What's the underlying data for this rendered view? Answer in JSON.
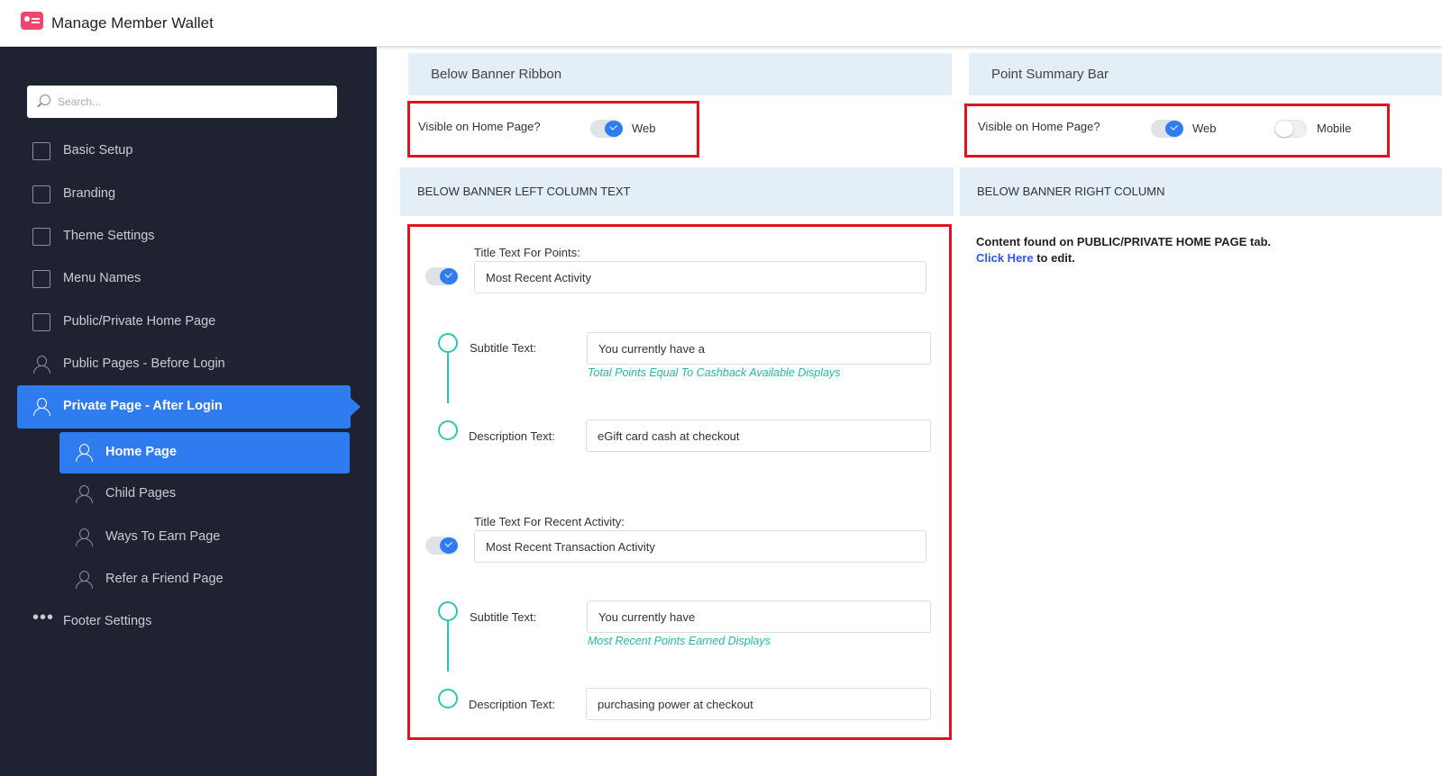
{
  "header": {
    "title": "Manage Member Wallet"
  },
  "sidebar": {
    "search_placeholder": "Search...",
    "items": [
      {
        "label": "Basic Setup"
      },
      {
        "label": "Branding"
      },
      {
        "label": "Theme Settings"
      },
      {
        "label": "Menu Names"
      },
      {
        "label": "Public/Private Home Page"
      },
      {
        "label": "Public Pages - Before Login"
      },
      {
        "label": "Private Page - After Login"
      },
      {
        "label": "Home Page"
      },
      {
        "label": "Child Pages"
      },
      {
        "label": "Ways To Earn Page"
      },
      {
        "label": "Refer a Friend Page"
      },
      {
        "label": "Footer Settings"
      }
    ]
  },
  "below_banner_ribbon": {
    "title": "Below Banner Ribbon",
    "visible_label": "Visible on Home Page?",
    "web_label": "Web",
    "web_on": true
  },
  "point_summary_bar": {
    "title": "Point Summary Bar",
    "visible_label": "Visible on Home Page?",
    "web_label": "Web",
    "web_on": true,
    "mobile_label": "Mobile",
    "mobile_on": false
  },
  "left_column": {
    "title": "BELOW BANNER LEFT COLUMN TEXT",
    "points": {
      "title_label": "Title Text For Points:",
      "title_value": "Most Recent Activity",
      "subtitle_label": "Subtitle Text:",
      "subtitle_value": "You currently have a",
      "subtitle_hint": "Total Points Equal To Cashback Available Displays",
      "description_label": "Description Text:",
      "description_value": "eGift card cash at checkout"
    },
    "recent": {
      "title_label": "Title Text For Recent Activity:",
      "title_value": "Most Recent Transaction Activity",
      "subtitle_label": "Subtitle Text:",
      "subtitle_value": "You currently have",
      "subtitle_hint": "Most Recent Points Earned Displays",
      "description_label": "Description Text:",
      "description_value": "purchasing power at checkout"
    }
  },
  "right_column": {
    "title": "BELOW BANNER RIGHT COLUMN",
    "content_text": "Content found on PUBLIC/PRIVATE HOME PAGE tab.",
    "link_text": "Click Here",
    "link_suffix": " to edit."
  }
}
